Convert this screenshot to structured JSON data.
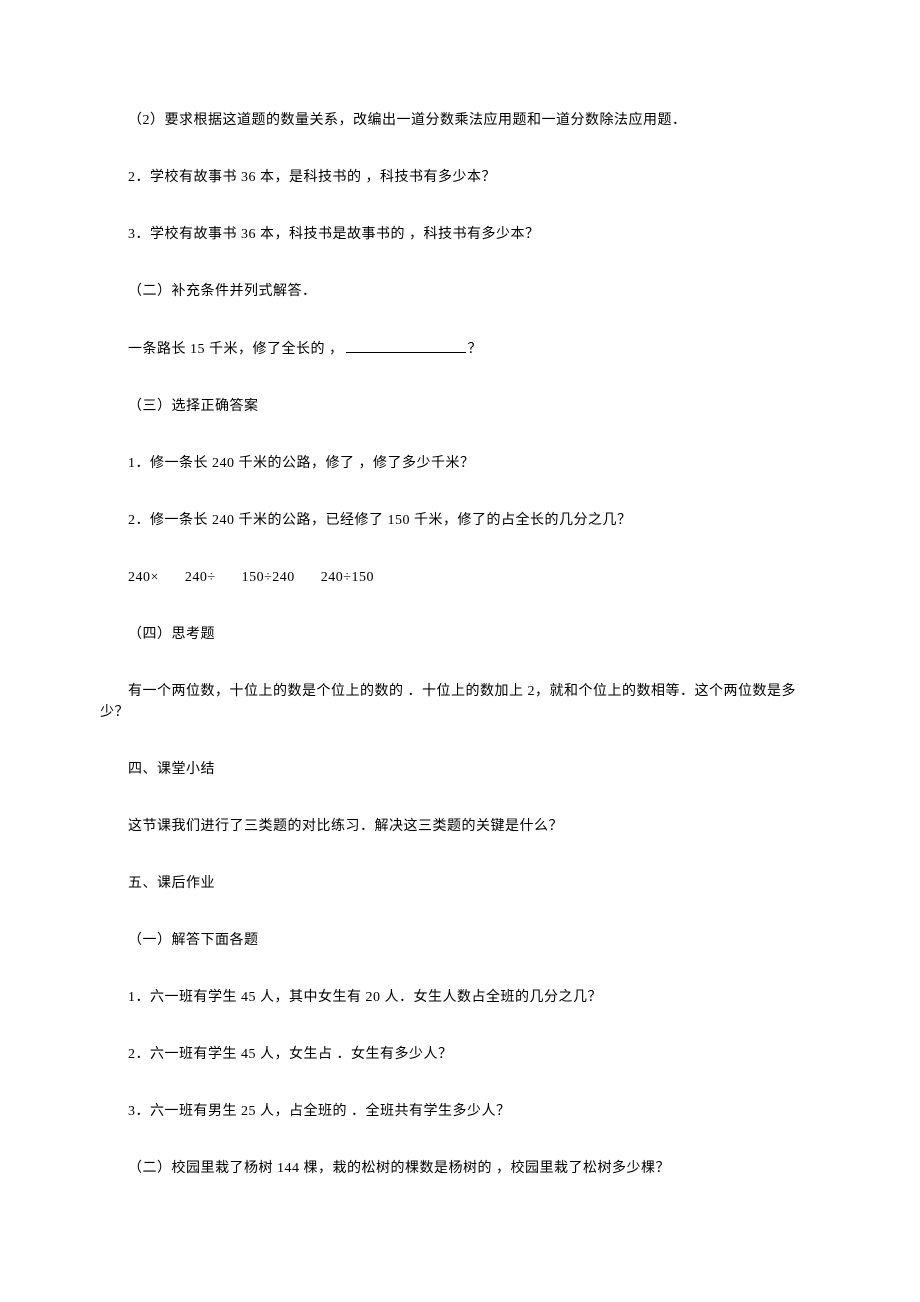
{
  "p1": "（2）要求根据这道题的数量关系，改编出一道分数乘法应用题和一道分数除法应用题．",
  "p2": "2．学校有故事书 36 本，是科技书的 ，科技书有多少本？",
  "p3": "3．学校有故事书 36 本，科技书是故事书的 ，科技书有多少本？",
  "p4": "（二）补充条件并列式解答．",
  "p5_before": "一条路长 15 千米，修了全长的 ，",
  "p5_after": "？",
  "p6": "（三）选择正确答案",
  "p7": "1．修一条长 240 千米的公路，修了 ，修了多少千米？",
  "p8": "2．修一条长 240 千米的公路，已经修了 150 千米，修了的占全长的几分之几？",
  "expr1": "240×",
  "expr2": "240÷",
  "expr3": "150÷240",
  "expr4": "240÷150",
  "p9": "（四）思考题",
  "p10": "有一个两位数，十位上的数是个位上的数的 ．十位上的数加上 2，就和个位上的数相等．这个两位数是多少？",
  "p11": "四、课堂小结",
  "p12": "这节课我们进行了三类题的对比练习．解决这三类题的关键是什么？",
  "p13": "五、课后作业",
  "p14": "（一）解答下面各题",
  "p15": "1．六一班有学生 45 人，其中女生有 20 人．女生人数占全班的几分之几？",
  "p16": "2．六一班有学生 45 人，女生占 ．女生有多少人？",
  "p17": "3．六一班有男生 25 人，占全班的 ．全班共有学生多少人？",
  "p18": "（二）校园里栽了杨树 144 棵，栽的松树的棵数是杨树的 ，校园里栽了松树多少棵？"
}
